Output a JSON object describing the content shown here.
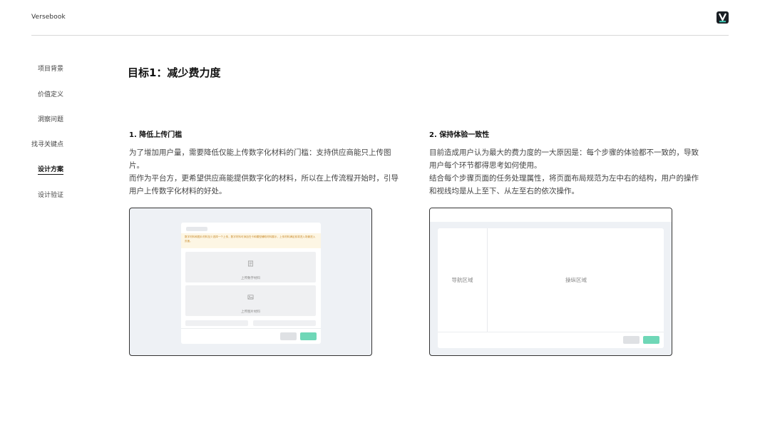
{
  "header": {
    "brand": "Versebook",
    "logo_icon": "versebook-logo-icon"
  },
  "sidebar": {
    "items": [
      {
        "label": "项目背景",
        "active": false
      },
      {
        "label": "价值定义",
        "active": false
      },
      {
        "label": "洞察问题",
        "active": false
      },
      {
        "label": "找寻关键点",
        "active": false
      },
      {
        "label": "设计方案",
        "active": true
      },
      {
        "label": "设计验证",
        "active": false
      }
    ]
  },
  "main": {
    "title": "目标1：减少费力度",
    "sections": [
      {
        "heading": "1. 降低上传门槛",
        "paragraphs": [
          "为了增加用户量，需要降低仅能上传数字化材料的门槛：支持供应商能只上传图片。",
          "而作为平台方，更希望供应商能提供数字化的材料，所以在上传流程开始时，引导用户上传数字化材料的好处。"
        ]
      },
      {
        "heading": "2. 保持体验一致性",
        "paragraphs": [
          "目前造成用户认为最大的费力度的一大原因是：每个步骤的体验都不一致的，导致用户每个环节都得思考如何使用。",
          "结合每个步骤页面的任务处理属性，将页面布局规范为左中右的结构，用户的操作和视线均是从上至下、从左至右的依次操作。"
        ]
      }
    ],
    "mock1": {
      "notice": "数字材料和图片材料至少选择一个上传，数字材料可添加在卡和模型辅助材料展示，上传材料满足前将进入场景进入页面。",
      "upload_digital": "上传数字材料",
      "upload_image": "上传图片材料"
    },
    "mock2": {
      "nav_area": "导航区域",
      "op_area": "操纵区域"
    }
  },
  "colors": {
    "accent_green": "#6fd7b7",
    "notice_bg": "#fdf6e4",
    "frame_bg": "#eef1f5"
  }
}
